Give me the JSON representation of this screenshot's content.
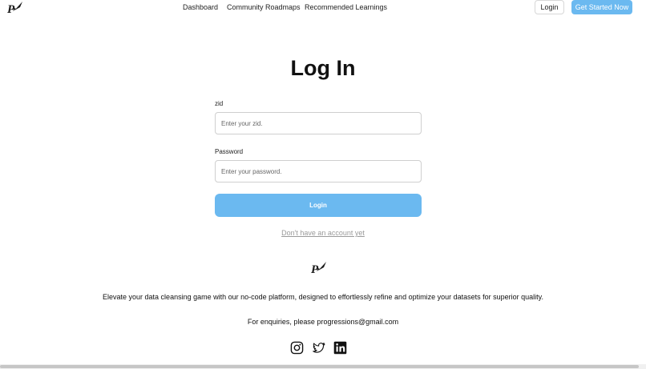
{
  "header": {
    "logo_icon": "rocket-p-logo-icon",
    "nav": [
      "Dashboard",
      "Community Roadmaps",
      "Recommended Learnings"
    ],
    "login_label": "Login",
    "get_started_label": "Get Started Now"
  },
  "form": {
    "title": "Log In",
    "zid_label": "zid",
    "zid_placeholder": "Enter your zid.",
    "password_label": "Password",
    "password_placeholder": "Enter your password.",
    "submit_label": "Login",
    "signup_link": "Don't have an account yet"
  },
  "footer": {
    "logo_icon": "rocket-p-logo-icon",
    "description": "Elevate your data cleansing game with our no-code platform, designed to effortlessly refine and optimize your datasets for superior quality.",
    "contact": "For enquiries, please progressions@gmail.com",
    "social_icons": [
      "instagram-icon",
      "twitter-icon",
      "linkedin-icon"
    ]
  },
  "colors": {
    "accent": "#6bb9f0",
    "link_muted": "#9a9a9a"
  }
}
